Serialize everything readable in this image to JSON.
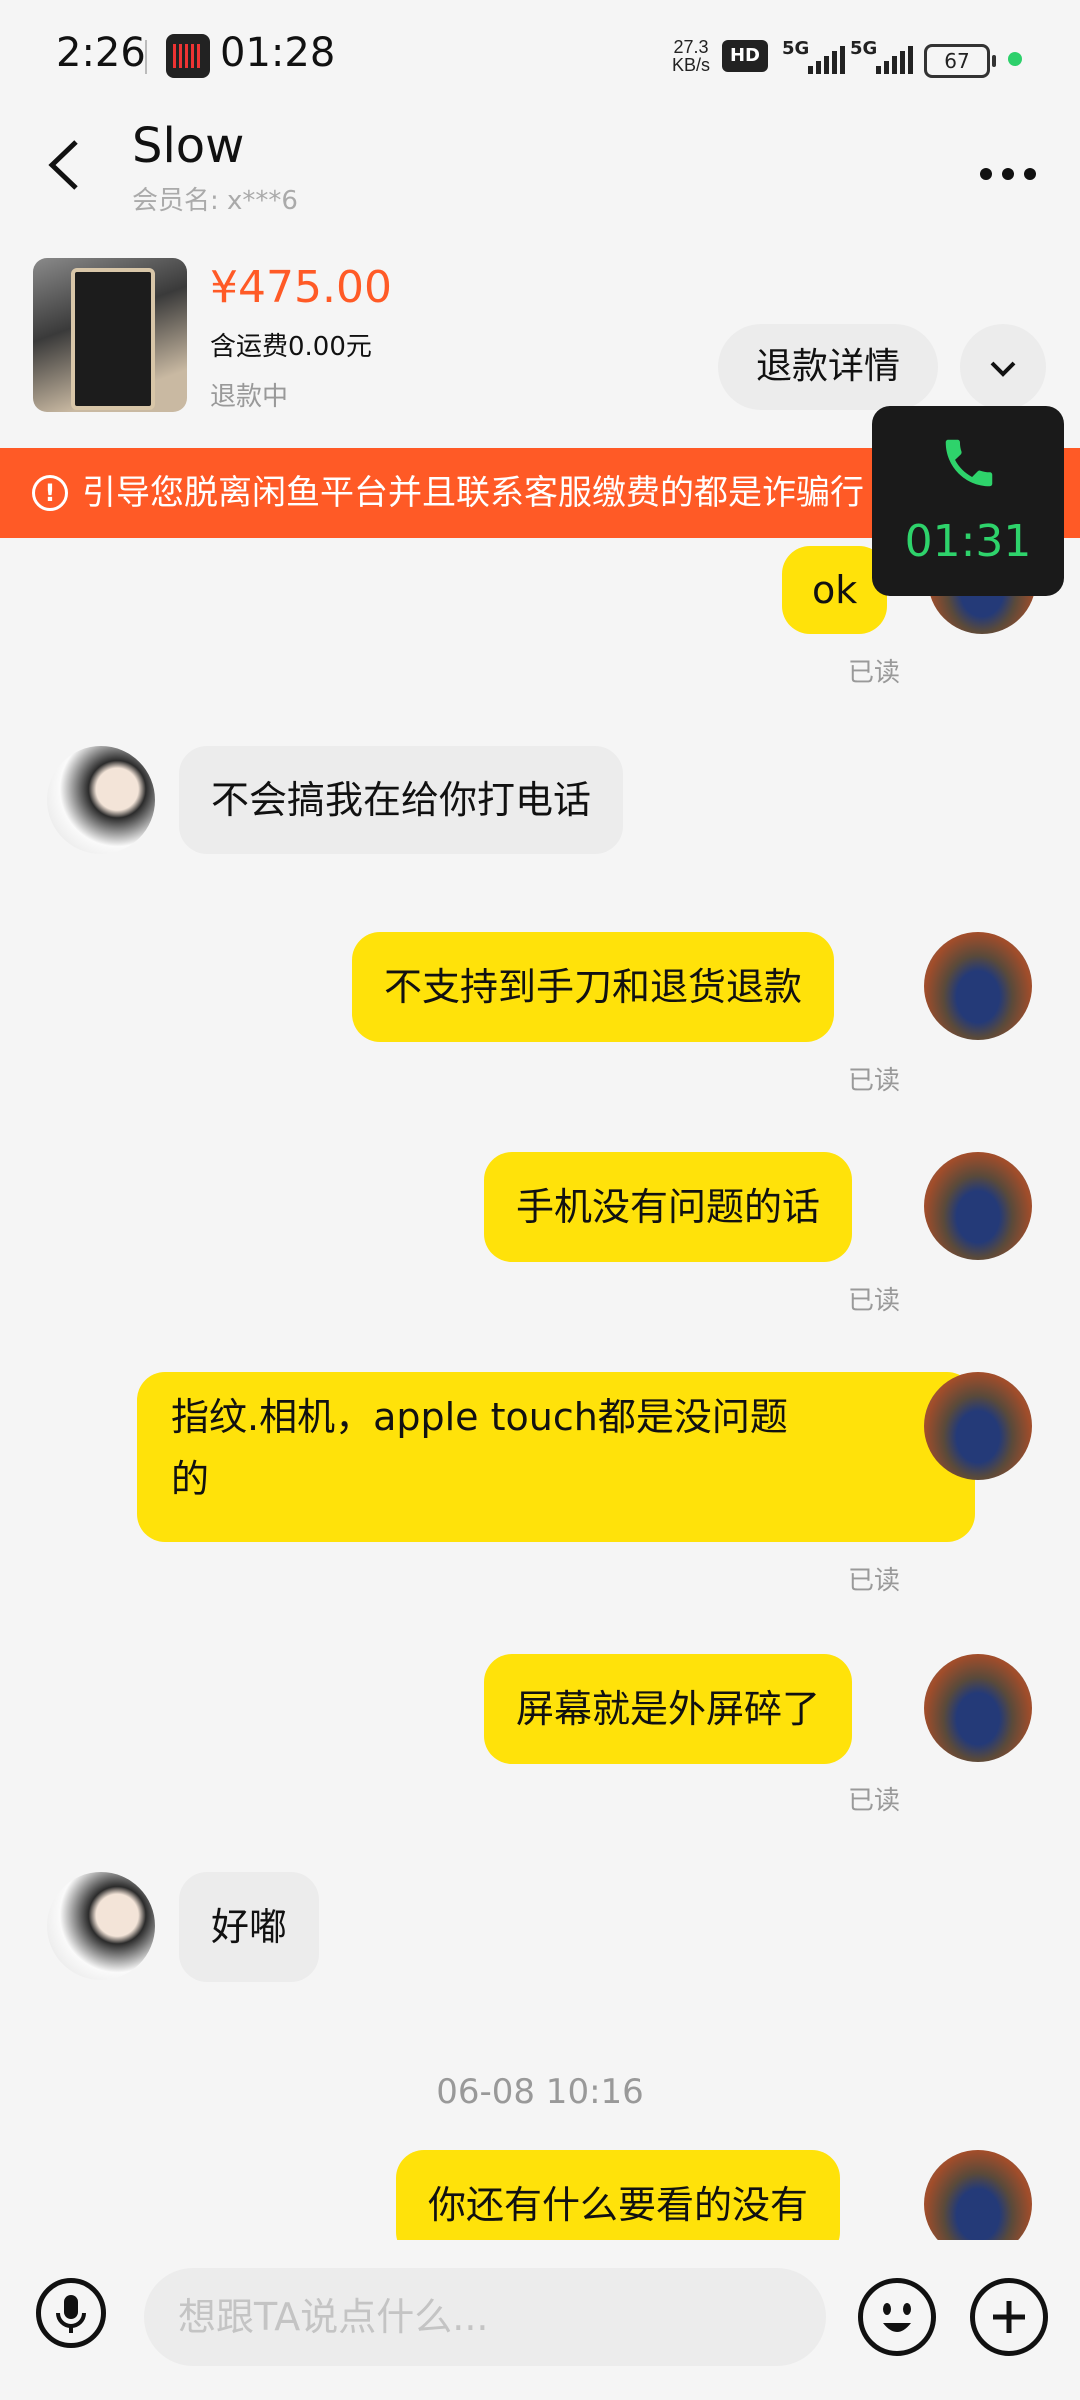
{
  "status_bar": {
    "time": "2:26",
    "recording_time": "01:28",
    "net_speed": "27.3",
    "net_unit": "KB/s",
    "hd": "HD",
    "sim1": "5G",
    "sim2": "5G",
    "battery": "67"
  },
  "header": {
    "name": "Slow",
    "member_label": "会员名: x***6"
  },
  "product": {
    "price": "¥475.00",
    "shipping": "含运费0.00元",
    "status": "退款中",
    "refund_button": "退款详情"
  },
  "warning": {
    "text": "引导您脱离闲鱼平台并且联系客服缴费的都是诈骗行"
  },
  "call": {
    "duration": "01:31"
  },
  "messages": [
    {
      "side": "out",
      "text": "ok",
      "read": "已读"
    },
    {
      "side": "in",
      "text": "不会搞我在给你打电话"
    },
    {
      "side": "out",
      "text": "不支持到手刀和退货退款",
      "read": "已读"
    },
    {
      "side": "out",
      "text": "手机没有问题的话",
      "read": "已读"
    },
    {
      "side": "out",
      "text_line1": "指纹.相机，apple touch都是没问题",
      "text_line2": "的",
      "read": "已读"
    },
    {
      "side": "out",
      "text": "屏幕就是外屏碎了",
      "read": "已读"
    },
    {
      "side": "in",
      "text": "好嘟"
    },
    {
      "side": "out",
      "text": "你还有什么要看的没有"
    }
  ],
  "timestamp": "06-08 10:16",
  "input": {
    "placeholder": "想跟TA说点什么..."
  },
  "colors": {
    "accent_orange": "#ff5a26",
    "bubble_yellow": "#ffe20a",
    "call_green": "#2ed36b"
  }
}
